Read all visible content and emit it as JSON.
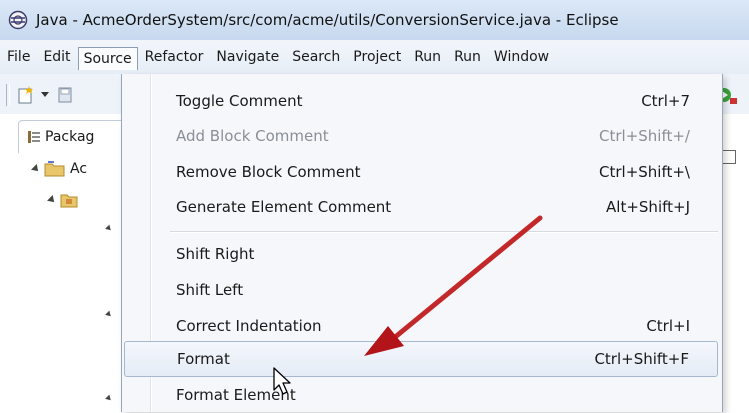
{
  "window": {
    "title": "Java - AcmeOrderSystem/src/com/acme/utils/ConversionService.java - Eclipse"
  },
  "menubar": {
    "items": [
      "File",
      "Edit",
      "Source",
      "Refactor",
      "Navigate",
      "Search",
      "Project",
      "Run",
      "Run",
      "Window"
    ],
    "open_item": "Source"
  },
  "package_explorer": {
    "tab_label": "Packag",
    "project_label": "Ac"
  },
  "source_menu": {
    "items": [
      {
        "label": "Toggle Comment",
        "accel": "Ctrl+7",
        "enabled": true
      },
      {
        "label": "Add Block Comment",
        "accel": "Ctrl+Shift+/",
        "enabled": false
      },
      {
        "label": "Remove Block Comment",
        "accel": "Ctrl+Shift+\\",
        "enabled": true
      },
      {
        "label": "Generate Element Comment",
        "accel": "Alt+Shift+J",
        "enabled": true
      },
      {
        "label": "Shift Right",
        "accel": "",
        "enabled": true
      },
      {
        "label": "Shift Left",
        "accel": "",
        "enabled": true
      },
      {
        "label": "Correct Indentation",
        "accel": "Ctrl+I",
        "enabled": true
      },
      {
        "label": "Format",
        "accel": "Ctrl+Shift+F",
        "enabled": true,
        "highlighted": true
      },
      {
        "label": "Format Element",
        "accel": "",
        "enabled": true
      }
    ]
  },
  "colors": {
    "arrow": "#c0181e",
    "menu_highlight": "#e5ecf6",
    "disabled_text": "#8a8f97"
  },
  "icons": [
    "eclipse-icon",
    "new-wizard-icon",
    "save-icon",
    "package-explorer-icon",
    "project-folder-icon",
    "package-icon",
    "run-icon",
    "mouse-pointer-icon"
  ]
}
